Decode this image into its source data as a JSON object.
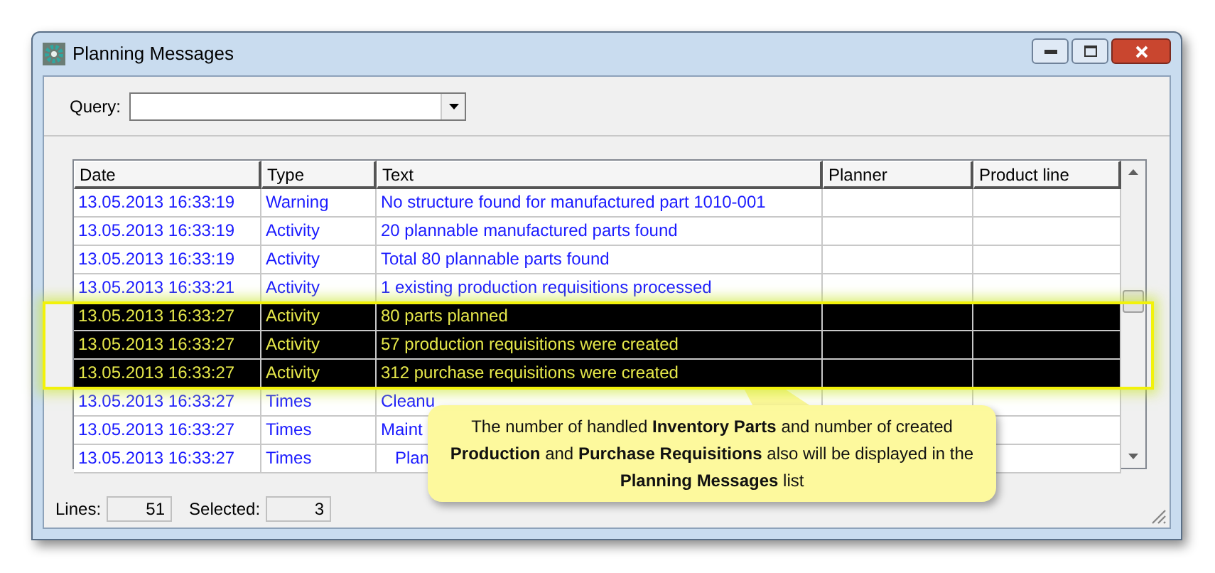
{
  "window": {
    "title": "Planning Messages"
  },
  "query": {
    "label": "Query:"
  },
  "table": {
    "columns": [
      "Date",
      "Type",
      "Text",
      "Planner",
      "Product line"
    ],
    "rows": [
      {
        "date": "13.05.2013 16:33:19",
        "type": "Warning",
        "text": "No structure found for manufactured part 1010-001",
        "selected": false
      },
      {
        "date": "13.05.2013 16:33:19",
        "type": "Activity",
        "text": "20 plannable manufactured parts found",
        "selected": false
      },
      {
        "date": "13.05.2013 16:33:19",
        "type": "Activity",
        "text": "Total 80 plannable parts found",
        "selected": false
      },
      {
        "date": "13.05.2013 16:33:21",
        "type": "Activity",
        "text": "1 existing production requisitions processed",
        "selected": false
      },
      {
        "date": "13.05.2013 16:33:27",
        "type": "Activity",
        "text": "80 parts planned",
        "selected": true
      },
      {
        "date": "13.05.2013 16:33:27",
        "type": "Activity",
        "text": "57 production requisitions were created",
        "selected": true
      },
      {
        "date": "13.05.2013 16:33:27",
        "type": "Activity",
        "text": "312 purchase requisitions were created",
        "selected": true
      },
      {
        "date": "13.05.2013 16:33:27",
        "type": "Times",
        "text": "Cleanu",
        "selected": false
      },
      {
        "date": "13.05.2013 16:33:27",
        "type": "Times",
        "text": "Maint",
        "selected": false
      },
      {
        "date": "13.05.2013 16:33:27",
        "type": "Times",
        "text": "   Plan",
        "selected": false
      }
    ]
  },
  "status_bar": {
    "lines_label": "Lines:",
    "lines": "51",
    "selected_label": "Selected:",
    "selected": "3"
  },
  "callout": {
    "text": "The number of handled **Inventory Parts** and number of created **Production** and **Purchase Requisitions** also will be displayed in the **Planning Messages** list"
  }
}
